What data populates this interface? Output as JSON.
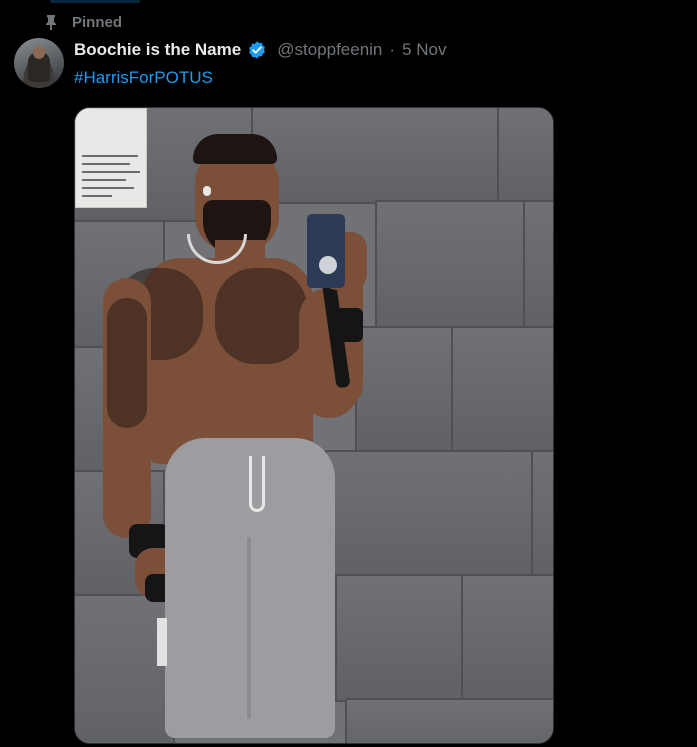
{
  "pinned": {
    "icon": "pin-icon",
    "label": "Pinned"
  },
  "post": {
    "display_name": "Boochie is the Name",
    "verified_icon": "verified-badge-icon",
    "handle": "@stoppfeenin",
    "separator": "·",
    "timestamp": "5 Nov",
    "hashtag": "#HarrisForPOTUS"
  },
  "media": {
    "type": "photo"
  },
  "colors": {
    "background": "#000000",
    "text_primary": "#e7e9ea",
    "text_secondary": "#71767b",
    "accent": "#1d9bf0"
  }
}
